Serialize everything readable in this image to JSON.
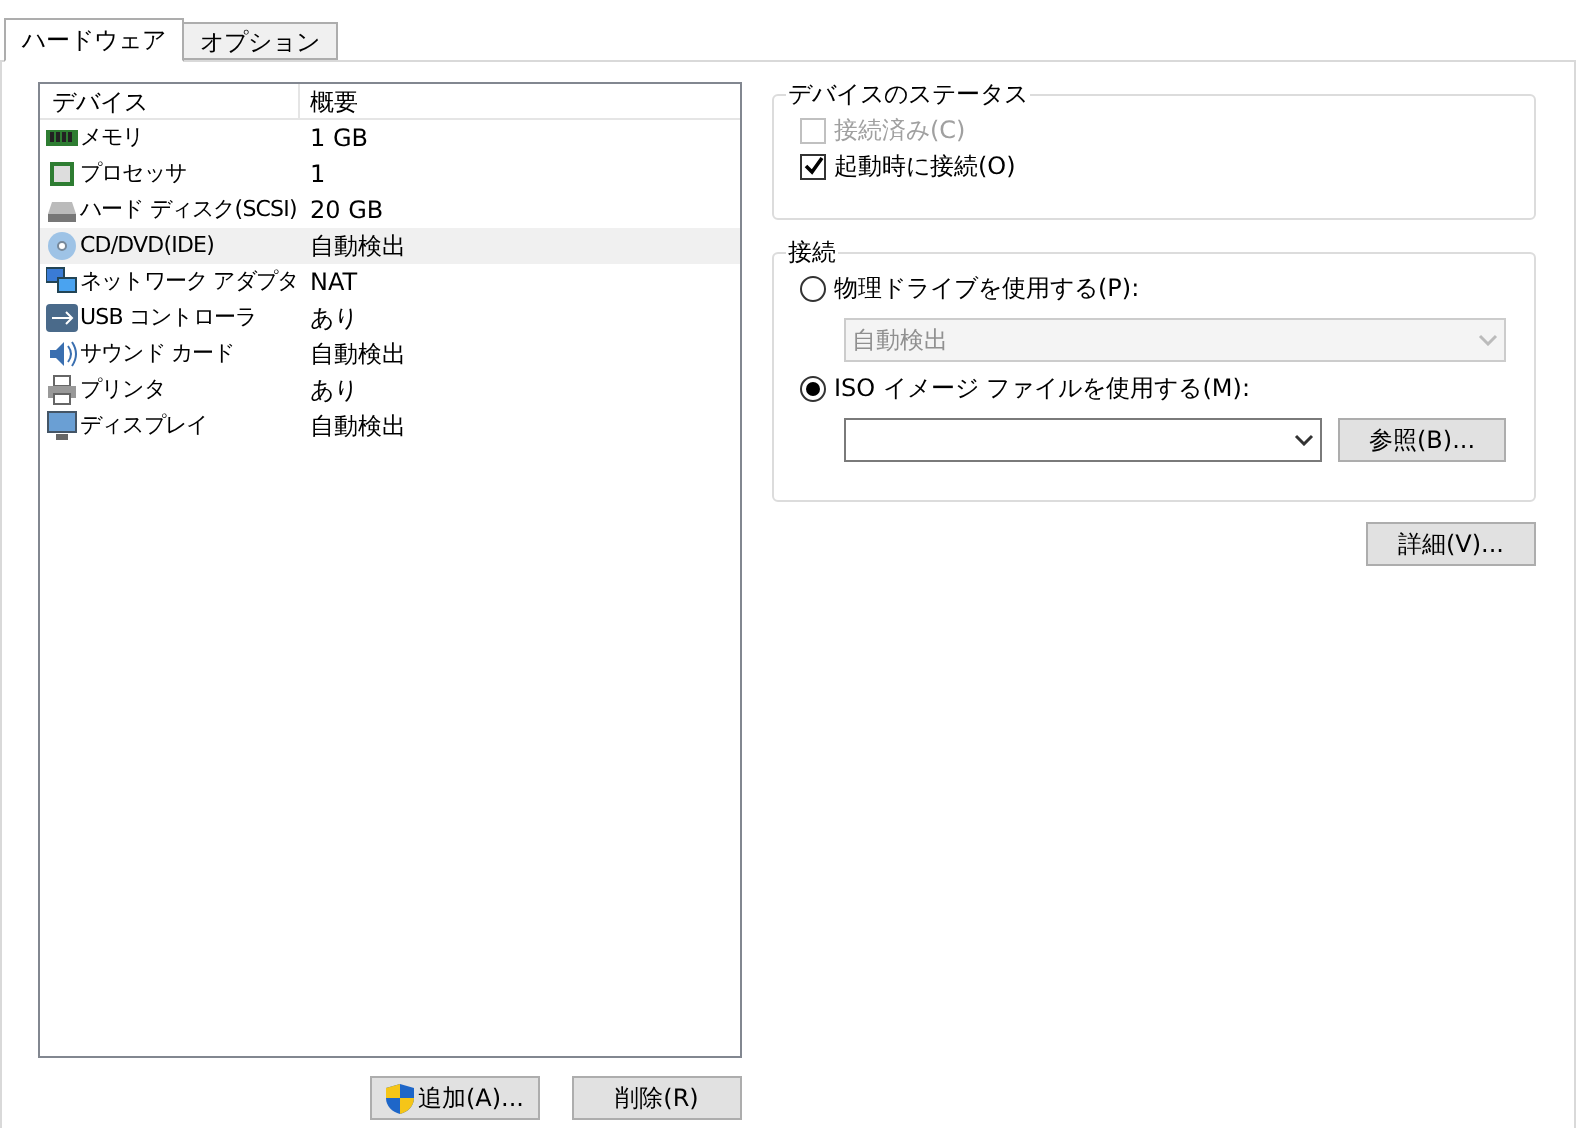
{
  "tabs": [
    {
      "label": "ハードウェア",
      "selected": true
    },
    {
      "label": "オプション",
      "selected": false
    }
  ],
  "device_table": {
    "columns": [
      "デバイス",
      "概要"
    ],
    "rows": [
      {
        "kind": "memory",
        "device": "メモリ",
        "summary": "1 GB",
        "selected": false
      },
      {
        "kind": "processor",
        "device": "プロセッサ",
        "summary": "1",
        "selected": false
      },
      {
        "kind": "disk",
        "device": "ハード ディスク(SCSI)",
        "summary": "20 GB",
        "selected": false
      },
      {
        "kind": "cdrom",
        "device": "CD/DVD(IDE)",
        "summary": "自動検出",
        "selected": true
      },
      {
        "kind": "network",
        "device": "ネットワーク アダプタ",
        "summary": "NAT",
        "selected": false
      },
      {
        "kind": "usb",
        "device": "USB コントローラ",
        "summary": "あり",
        "selected": false
      },
      {
        "kind": "sound",
        "device": "サウンド カード",
        "summary": "自動検出",
        "selected": false
      },
      {
        "kind": "printer",
        "device": "プリンタ",
        "summary": "あり",
        "selected": false
      },
      {
        "kind": "display",
        "device": "ディスプレイ",
        "summary": "自動検出",
        "selected": false
      }
    ]
  },
  "list_buttons": [
    "追加(A)...",
    "削除(R)"
  ],
  "device_status": {
    "title": "デバイスのステータス",
    "options": [
      {
        "label": "接続済み(C)",
        "checked": false,
        "disabled": true
      },
      {
        "label": "起動時に接続(O)",
        "checked": true,
        "disabled": false
      }
    ]
  },
  "connection": {
    "title": "接続",
    "physical": {
      "label": "物理ドライブを使用する(P):",
      "selected": false,
      "value": "自動検出",
      "disabled": true
    },
    "iso": {
      "label": "ISO イメージ ファイルを使用する(M):",
      "selected": true,
      "browse_button": "参照(B)..."
    }
  },
  "advanced_button": "詳細(V)..."
}
